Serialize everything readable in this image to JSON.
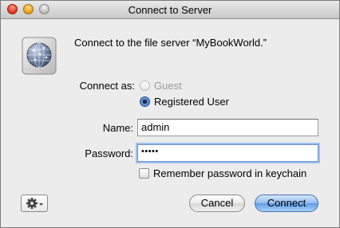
{
  "window": {
    "title": "Connect to Server"
  },
  "icons": {
    "server": "network-server-globe-icon",
    "gear": "gear-icon"
  },
  "prompt": "Connect to the file server “MyBookWorld.”",
  "connect_as": {
    "label": "Connect as:",
    "options": [
      {
        "label": "Guest",
        "selected": false,
        "enabled": false
      },
      {
        "label": "Registered User",
        "selected": true,
        "enabled": true
      }
    ]
  },
  "name": {
    "label": "Name:",
    "value": "admin"
  },
  "password": {
    "label": "Password:",
    "value": "•••••",
    "length": 5
  },
  "remember": {
    "label": "Remember password in keychain",
    "checked": false
  },
  "buttons": {
    "cancel": "Cancel",
    "connect": "Connect"
  },
  "colors": {
    "default_button": "#6aa6ec",
    "focus_ring": "#9ec0ee",
    "window_bg": "#ececec"
  }
}
